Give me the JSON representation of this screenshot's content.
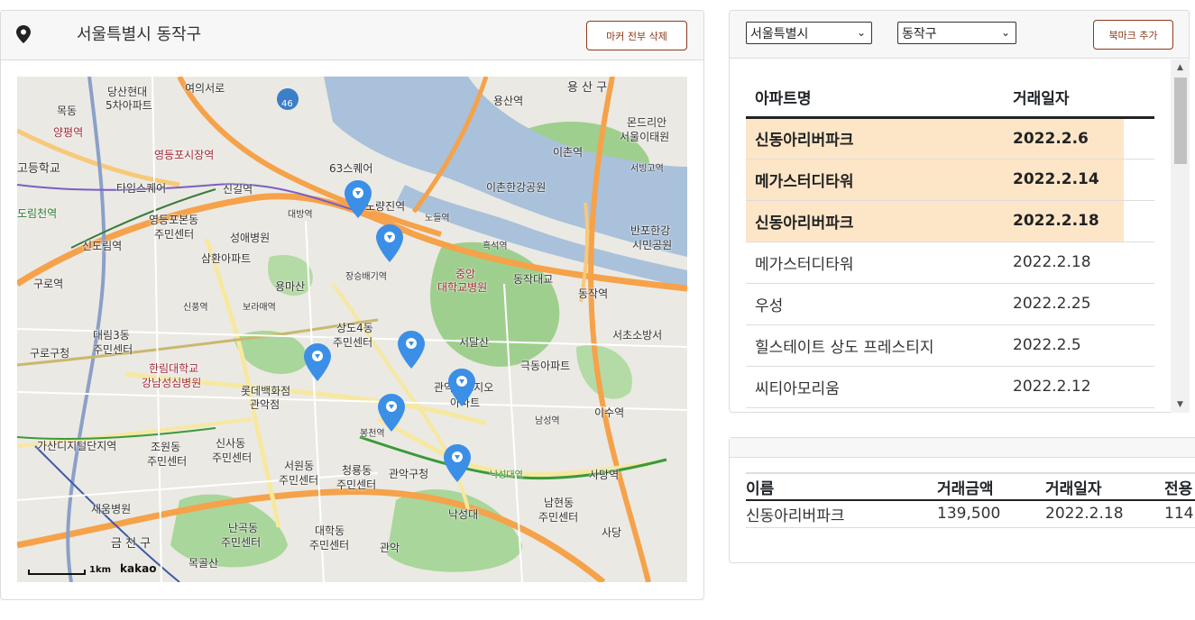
{
  "left_panel": {
    "location_title": "서울특별시 동작구",
    "clear_markers_button": "마커 전부 삭제"
  },
  "map": {
    "labels": [
      {
        "text": "여의서로"
      },
      {
        "text": "당산현대"
      },
      {
        "text": "5차아파트"
      },
      {
        "text": "목동"
      },
      {
        "text": "양평역"
      },
      {
        "text": "영등포시장역"
      },
      {
        "text": "고등학교"
      },
      {
        "text": "타임스퀘어"
      },
      {
        "text": "신길역"
      },
      {
        "text": "대방역"
      },
      {
        "text": "영등포본동"
      },
      {
        "text": "주민센터"
      },
      {
        "text": "성애병원"
      },
      {
        "text": "도림천역"
      },
      {
        "text": "신도림역"
      },
      {
        "text": "삼환아파트"
      },
      {
        "text": "용마산"
      },
      {
        "text": "구로역"
      },
      {
        "text": "신풍역"
      },
      {
        "text": "보라매역"
      },
      {
        "text": "대림3동"
      },
      {
        "text": "주민센터"
      },
      {
        "text": "구로구청"
      },
      {
        "text": "한림대학교"
      },
      {
        "text": "강남성심병원"
      },
      {
        "text": "상도4동"
      },
      {
        "text": "주민센터"
      },
      {
        "text": "장승배기역"
      },
      {
        "text": "롯데백화점"
      },
      {
        "text": "관악점"
      },
      {
        "text": "가산디지털단지역"
      },
      {
        "text": "조원동"
      },
      {
        "text": "주민센터"
      },
      {
        "text": "신사동"
      },
      {
        "text": "주민센터"
      },
      {
        "text": "서원동"
      },
      {
        "text": "주민센터"
      },
      {
        "text": "청룡동"
      },
      {
        "text": "주민센터"
      },
      {
        "text": "관악구청"
      },
      {
        "text": "봉천역"
      },
      {
        "text": "새움병원"
      },
      {
        "text": "금 천 구"
      },
      {
        "text": "난곡동"
      },
      {
        "text": "주민센터"
      },
      {
        "text": "대학동"
      },
      {
        "text": "주민센터"
      },
      {
        "text": "목골산"
      },
      {
        "text": "관악"
      },
      {
        "text": "낙성대"
      },
      {
        "text": "용 산 구"
      },
      {
        "text": "용산역"
      },
      {
        "text": "몬드리안"
      },
      {
        "text": "서울이태원"
      },
      {
        "text": "이촌역"
      },
      {
        "text": "서빙고역"
      },
      {
        "text": "63스퀘어"
      },
      {
        "text": "노량진역"
      },
      {
        "text": "노들역"
      },
      {
        "text": "이촌한강공원"
      },
      {
        "text": "반포한강"
      },
      {
        "text": "시민공원"
      },
      {
        "text": "흑석역"
      },
      {
        "text": "중앙"
      },
      {
        "text": "대학교병원"
      },
      {
        "text": "동작대교"
      },
      {
        "text": "동작역"
      },
      {
        "text": "서달산"
      },
      {
        "text": "서초소방서"
      },
      {
        "text": "극동아파트"
      },
      {
        "text": "관악푸르지오"
      },
      {
        "text": "아파트"
      },
      {
        "text": "이수역"
      },
      {
        "text": "남성역"
      },
      {
        "text": "사당역"
      },
      {
        "text": "남현동"
      },
      {
        "text": "주민센터"
      },
      {
        "text": "사당"
      },
      {
        "text": "낙성대역"
      },
      {
        "text": "46"
      }
    ],
    "scale_text": "1km",
    "provider_logo": "kakao"
  },
  "filter": {
    "city_select": "서울특별시",
    "district_select": "동작구",
    "bookmark_button": "북마크 추가"
  },
  "apartment_list": {
    "headers": [
      "아파트명",
      "거래일자"
    ],
    "rows": [
      {
        "name": "신동아리버파크",
        "date": "2022.2.6",
        "highlighted": true
      },
      {
        "name": "메가스터디타워",
        "date": "2022.2.14",
        "highlighted": true
      },
      {
        "name": "신동아리버파크",
        "date": "2022.2.18",
        "highlighted": true
      },
      {
        "name": "메가스터디타워",
        "date": "2022.2.18",
        "highlighted": false
      },
      {
        "name": "우성",
        "date": "2022.2.25",
        "highlighted": false
      },
      {
        "name": "힐스테이트 상도 프레스티지",
        "date": "2022.2.5",
        "highlighted": false
      },
      {
        "name": "씨티아모리움",
        "date": "2022.2.12",
        "highlighted": false
      }
    ]
  },
  "detail": {
    "headers": [
      "이름",
      "거래금액",
      "거래일자",
      "전용"
    ],
    "row": {
      "name": "신동아리버파크",
      "amount": "139,500",
      "date": "2022.2.18",
      "area": "114."
    }
  },
  "colors": {
    "accent_button": "#8b3a1a",
    "highlight_row": "#fde6c8",
    "marker_blue": "#3b8fe6",
    "river": "#a9c1da",
    "park": "#9fcf8e",
    "major_road": "#f5a24a"
  }
}
